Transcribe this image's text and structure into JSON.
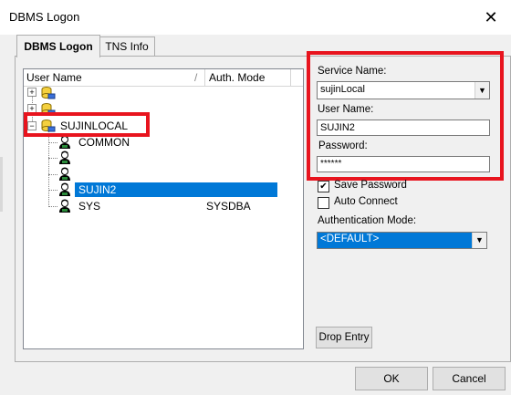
{
  "window": {
    "title": "DBMS Logon",
    "close_glyph": "✕"
  },
  "tabs": [
    {
      "label": "DBMS Logon",
      "active": true
    },
    {
      "label": "TNS Info",
      "active": false
    }
  ],
  "tree": {
    "columns": {
      "user_name": "User Name",
      "sort_glyph": "/",
      "auth_mode": "Auth. Mode"
    },
    "service": "SUJINLOCAL",
    "users": [
      {
        "name": "COMMON",
        "auth": ""
      },
      {
        "name": "",
        "auth": ""
      },
      {
        "name": "",
        "auth": ""
      },
      {
        "name": "SUJIN2",
        "auth": "",
        "selected": true
      },
      {
        "name": "SYS",
        "auth": "SYSDBA"
      }
    ],
    "expand_glyph": "+",
    "collapse_glyph": "−"
  },
  "form": {
    "service_name_label": "Service Name:",
    "service_name_value": "sujinLocal",
    "user_name_label": "User Name:",
    "user_name_value": "SUJIN2",
    "password_label": "Password:",
    "password_value": "******",
    "save_password_label": "Save Password",
    "save_password_checked": true,
    "auto_connect_label": "Auto Connect",
    "auto_connect_checked": false,
    "auth_mode_label": "Authentication Mode:",
    "auth_mode_value": "<DEFAULT>",
    "drop_entry_label": "Drop Entry",
    "check_glyph": "✔",
    "dropdown_glyph": "▼"
  },
  "buttons": {
    "ok": "OK",
    "cancel": "Cancel"
  },
  "colors": {
    "highlight": "#0078d7",
    "annotation": "#e8141e"
  }
}
